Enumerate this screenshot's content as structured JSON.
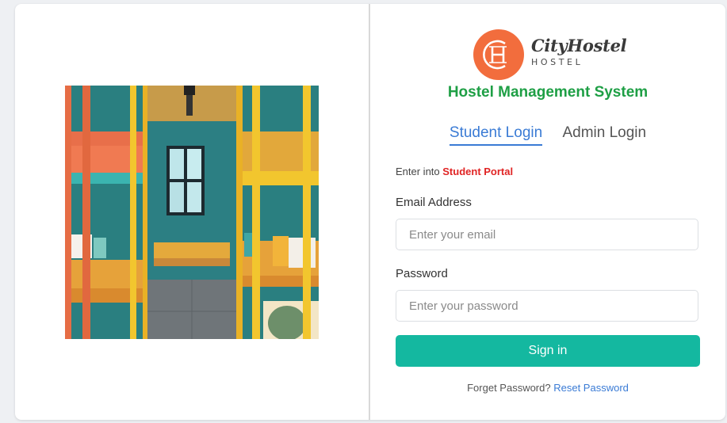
{
  "brand": {
    "name": "CityHostel",
    "tagline": "HOSTEL",
    "logo_color": "#f26d3d"
  },
  "system_title": "Hostel Management System",
  "tabs": [
    {
      "label": "Student Login",
      "active": true
    },
    {
      "label": "Admin Login",
      "active": false
    }
  ],
  "intro": {
    "prefix": "Enter into ",
    "highlight": "Student Portal"
  },
  "form": {
    "email_label": "Email Address",
    "email_placeholder": "Enter your email",
    "password_label": "Password",
    "password_placeholder": "Enter your password",
    "submit_label": "Sign in"
  },
  "footer": {
    "question": "Forget Password?",
    "link_label": "Reset Password"
  },
  "colors": {
    "accent_green": "#1e9f45",
    "tab_blue": "#3a7bd5",
    "button_teal": "#14b8a0",
    "highlight_red": "#e02424"
  }
}
